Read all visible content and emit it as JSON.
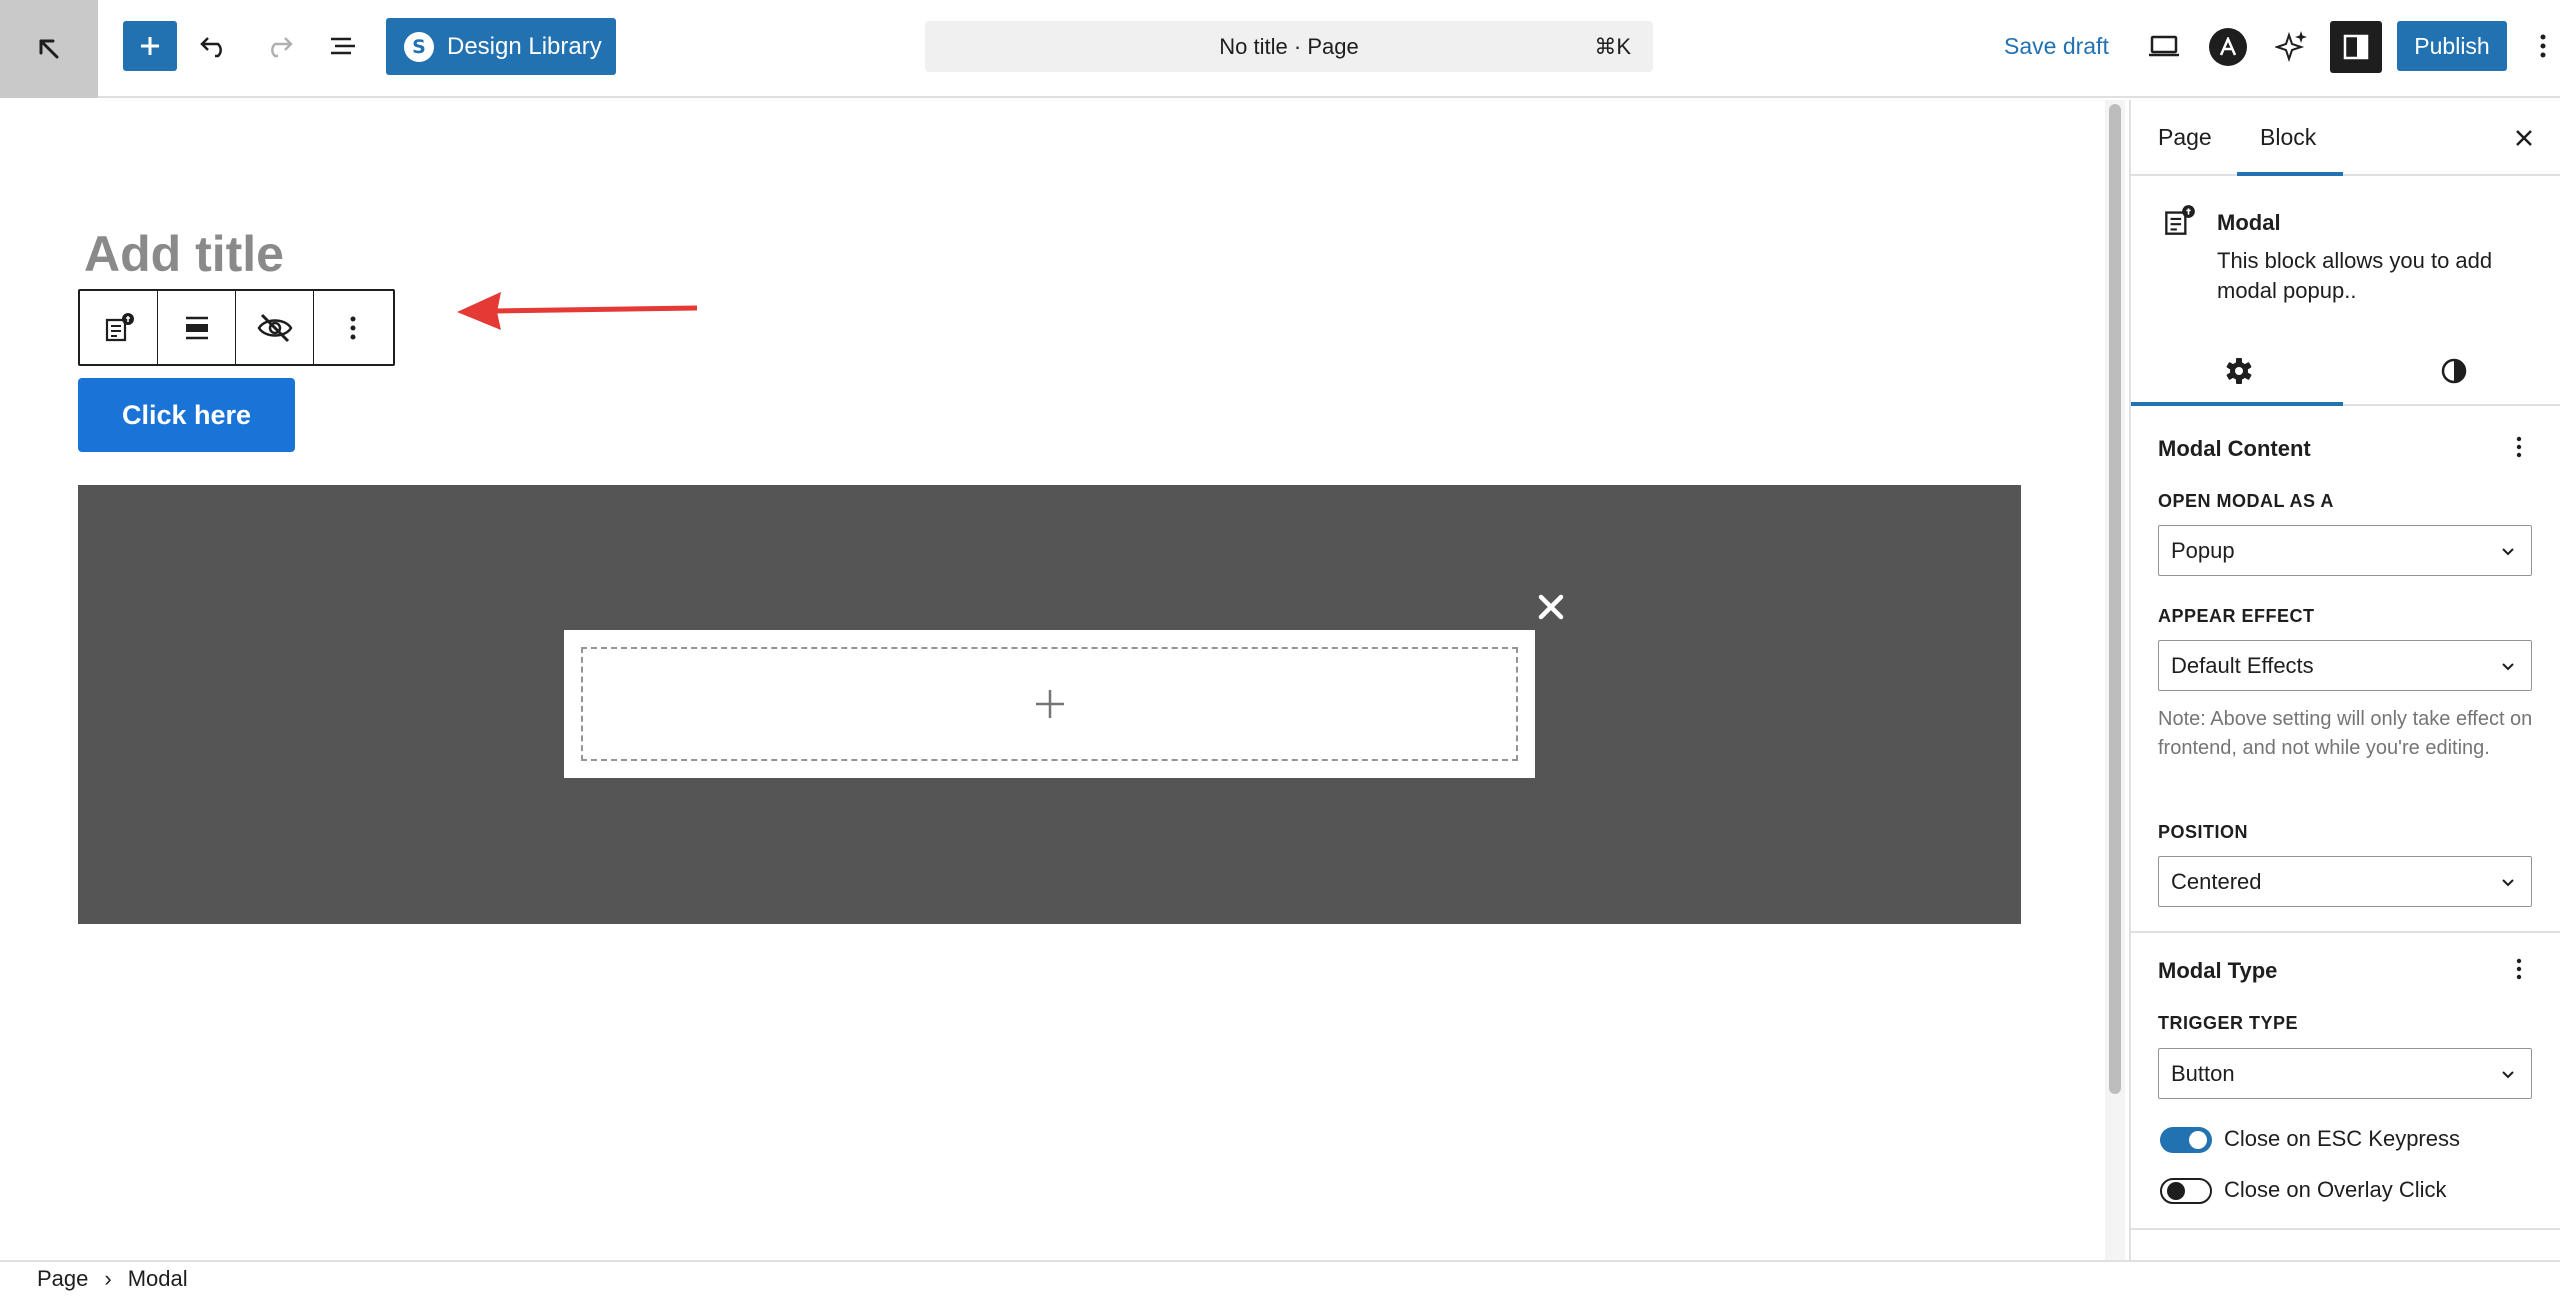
{
  "toolbar": {
    "design_library_label": "Design Library",
    "document_title": "No title · Page",
    "command_shortcut": "⌘K",
    "save_draft_label": "Save draft",
    "publish_label": "Publish",
    "accent_color": "#2271b1"
  },
  "canvas": {
    "title_placeholder": "Add title",
    "trigger_button_label": "Click here",
    "overlay_color": "#555555",
    "annotation_arrow_color": "#e53935"
  },
  "sidebar": {
    "tabs": [
      {
        "label": "Page"
      },
      {
        "label": "Block"
      }
    ],
    "active_tab": "Block",
    "block": {
      "name": "Modal",
      "description": "This block allows you to add modal popup.."
    },
    "icon_tabs": [
      "settings-icon",
      "styles-icon"
    ],
    "sections": {
      "modal_content": {
        "title": "Modal Content",
        "open_as_label": "OPEN MODAL AS A",
        "open_as_value": "Popup",
        "appear_effect_label": "APPEAR EFFECT",
        "appear_effect_value": "Default Effects",
        "note": "Note: Above setting will only take effect on frontend, and not while you're editing.",
        "position_label": "POSITION",
        "position_value": "Centered"
      },
      "modal_type": {
        "title": "Modal Type",
        "trigger_type_label": "TRIGGER TYPE",
        "trigger_type_value": "Button",
        "toggles": [
          {
            "label": "Close on ESC Keypress",
            "on": true
          },
          {
            "label": "Close on Overlay Click",
            "on": false
          }
        ]
      }
    }
  },
  "breadcrumb": [
    "Page",
    "Modal"
  ]
}
